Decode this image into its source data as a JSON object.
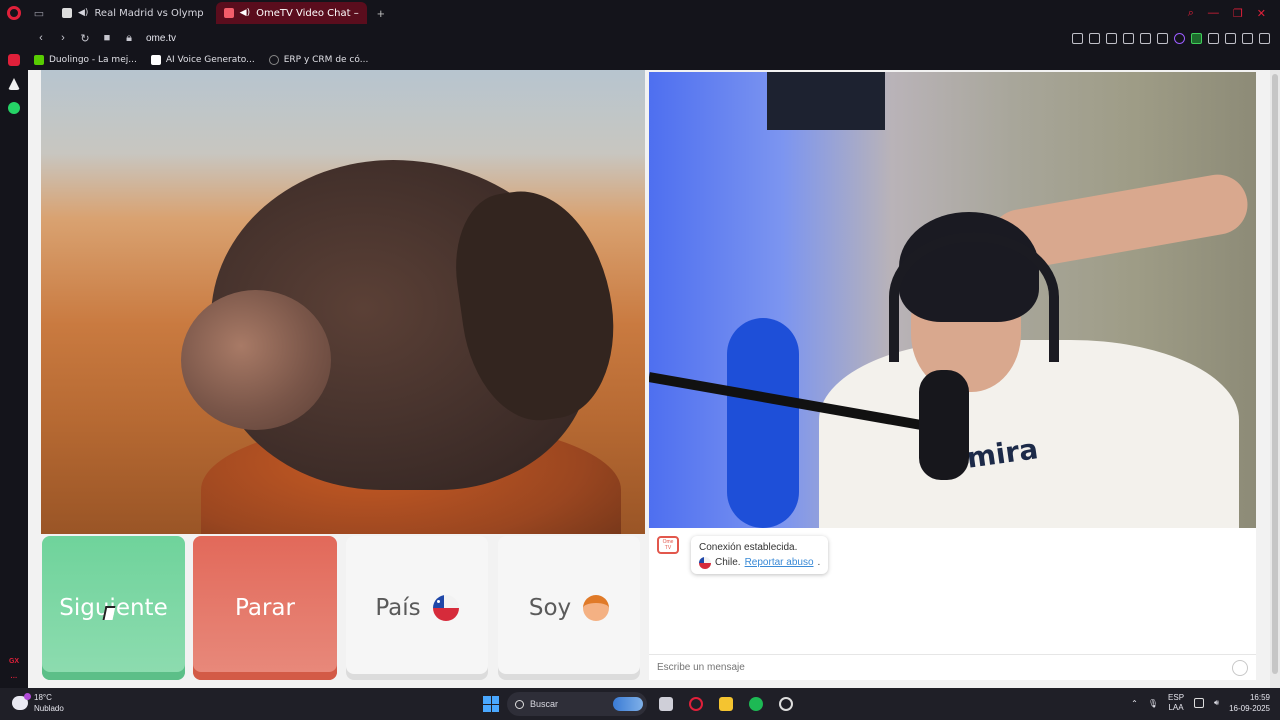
{
  "browser": {
    "tabs": [
      {
        "title": "Real Madrid vs Olymp",
        "active": false
      },
      {
        "title": "OmeTV Video Chat –",
        "active": true
      }
    ],
    "new_tab": "+",
    "url": "ome.tv",
    "bookmarks": [
      {
        "label": "Duolingo - La mej...",
        "color": "#58cc02"
      },
      {
        "label": "AI Voice Generato...",
        "color": "#ffffff"
      },
      {
        "label": "ERP y CRM de có...",
        "color": "#888888"
      }
    ],
    "sidebar_label": "GX"
  },
  "controls": {
    "next_label": "Siguiente",
    "stop_label": "Parar",
    "country_label": "País",
    "gender_label": "Soy"
  },
  "chat": {
    "logo_text": "Ome TV",
    "status": "Conexión establecida.",
    "country": "Chile.",
    "report_link": "Reportar abuso",
    "report_suffix": ".",
    "input_placeholder": "Escribe un mensaje"
  },
  "remote_video": {
    "shirt_text": "Emira"
  },
  "taskbar": {
    "temperature": "18°C",
    "weather": "Nublado",
    "search_label": "Buscar",
    "lang_line1": "ESP",
    "lang_line2": "LAA",
    "time": "16:59",
    "date": "16-09-2025"
  },
  "colors": {
    "accent_red": "#e0203a",
    "next_green": "#6fd39b",
    "stop_red": "#e2695a"
  }
}
